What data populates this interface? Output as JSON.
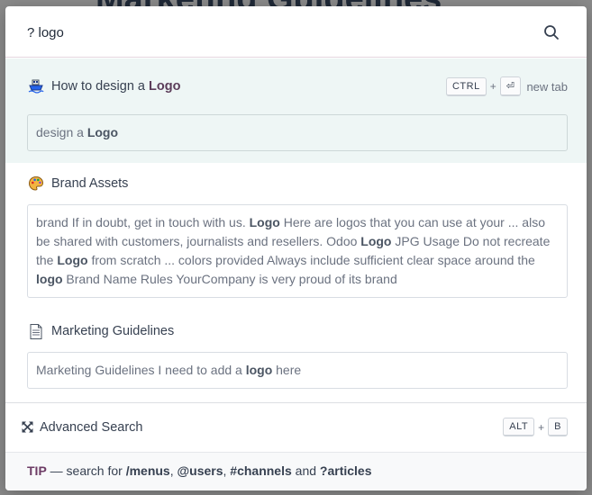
{
  "background": {
    "page_title": "Marketing Guidelines"
  },
  "search": {
    "value": "? logo"
  },
  "results": [
    {
      "icon": "ship-icon",
      "title_pre": "How to design a ",
      "title_bold": "Logo",
      "active": true,
      "shortcut": {
        "key1": "CTRL",
        "plus": "+",
        "key2": "⏎",
        "label": "new tab"
      },
      "snippet": [
        {
          "t": "design a ",
          "b": false
        },
        {
          "t": "Logo",
          "b": true
        }
      ]
    },
    {
      "icon": "palette-icon",
      "title_pre": "Brand Assets",
      "title_bold": "",
      "active": false,
      "snippet": [
        {
          "t": "brand If in doubt, get in touch with us. ",
          "b": false
        },
        {
          "t": "Logo",
          "b": true
        },
        {
          "t": " Here are logos that you can use at your ... also be shared with customers, journalists and resellers. Odoo ",
          "b": false
        },
        {
          "t": "Logo",
          "b": true
        },
        {
          "t": " JPG Usage Do not recreate the ",
          "b": false
        },
        {
          "t": "Logo",
          "b": true
        },
        {
          "t": " from scratch ... colors provided Always include sufficient clear space around the ",
          "b": false
        },
        {
          "t": "logo",
          "b": true
        },
        {
          "t": " Brand Name Rules YourCompany is very proud of its brand",
          "b": false
        }
      ]
    },
    {
      "icon": "document-icon",
      "title_pre": "Marketing Guidelines",
      "title_bold": "",
      "active": false,
      "snippet": [
        {
          "t": "Marketing Guidelines I need to add a ",
          "b": false
        },
        {
          "t": "logo",
          "b": true
        },
        {
          "t": " here",
          "b": false
        }
      ]
    }
  ],
  "advanced": {
    "label": "Advanced Search",
    "icon": "expand-arrows-icon",
    "shortcut": {
      "key1": "ALT",
      "plus": "+",
      "key2": "B"
    }
  },
  "tip": {
    "label": "TIP",
    "dash": " — search for ",
    "menus": "/menus",
    "sep1": ", ",
    "users": "@users",
    "sep2": ", ",
    "channels": "#channels",
    "and": " and ",
    "articles": "?articles"
  },
  "colors": {
    "accent": "#6d3c65",
    "active_bg": "#eef6f5"
  }
}
